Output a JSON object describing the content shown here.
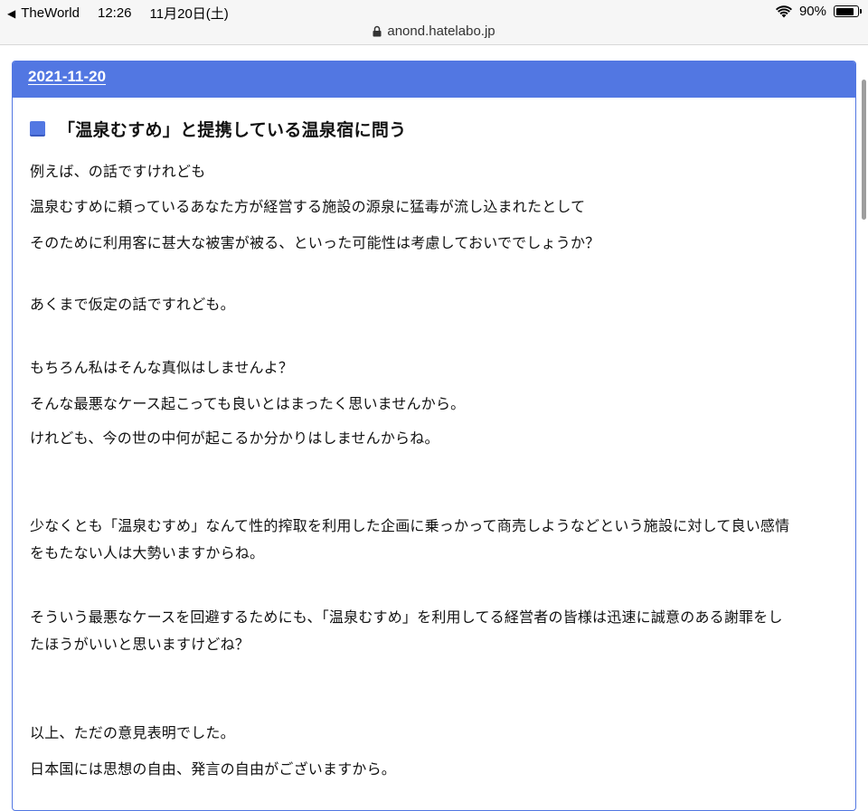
{
  "status_bar": {
    "back_app": "TheWorld",
    "time": "12:26",
    "date": "11月20日(土)",
    "battery": "90%",
    "battery_level": 0.9
  },
  "url_bar": {
    "url": "anond.hatelabo.jp",
    "icon": "lock-icon"
  },
  "article": {
    "date": "2021-11-20",
    "title": "「温泉むすめ」と提携している温泉宿に問う",
    "lines": [
      "例えば、の話ですけれども",
      "温泉むすめに頼っているあなた方が経営する施設の源泉に猛毒が流し込まれたとして",
      "そのために利用客に甚大な被害が被る、といった可能性は考慮しておいででしょうか？",
      "あくまで仮定の話ですれども。",
      "もちろん私はそんな真似はしませんよ？",
      "そんな最悪なケース起こっても良いとはまったく思いませんから。",
      "けれども、今の世の中何が起こるか分かりはしませんからね。",
      "少なくとも「温泉むすめ」なんて性的搾取を利用した企画に乗っかって商売しようなどという施設に対して良い感情",
      "をもたない人は大勢いますからね。",
      "そういう最悪なケースを回避するためにも、「温泉むすめ」を利用してる経営者の皆様は迅速に誠意のある謝罪をし",
      "たほうがいいと思いますけどね？",
      "以上、ただの意見表明でした。",
      "日本国には思想の自由、発言の自由がございますから。"
    ]
  },
  "colors": {
    "accent": "#5277e2",
    "statusbar_bg": "#f6f6f6",
    "text": "#111111"
  }
}
